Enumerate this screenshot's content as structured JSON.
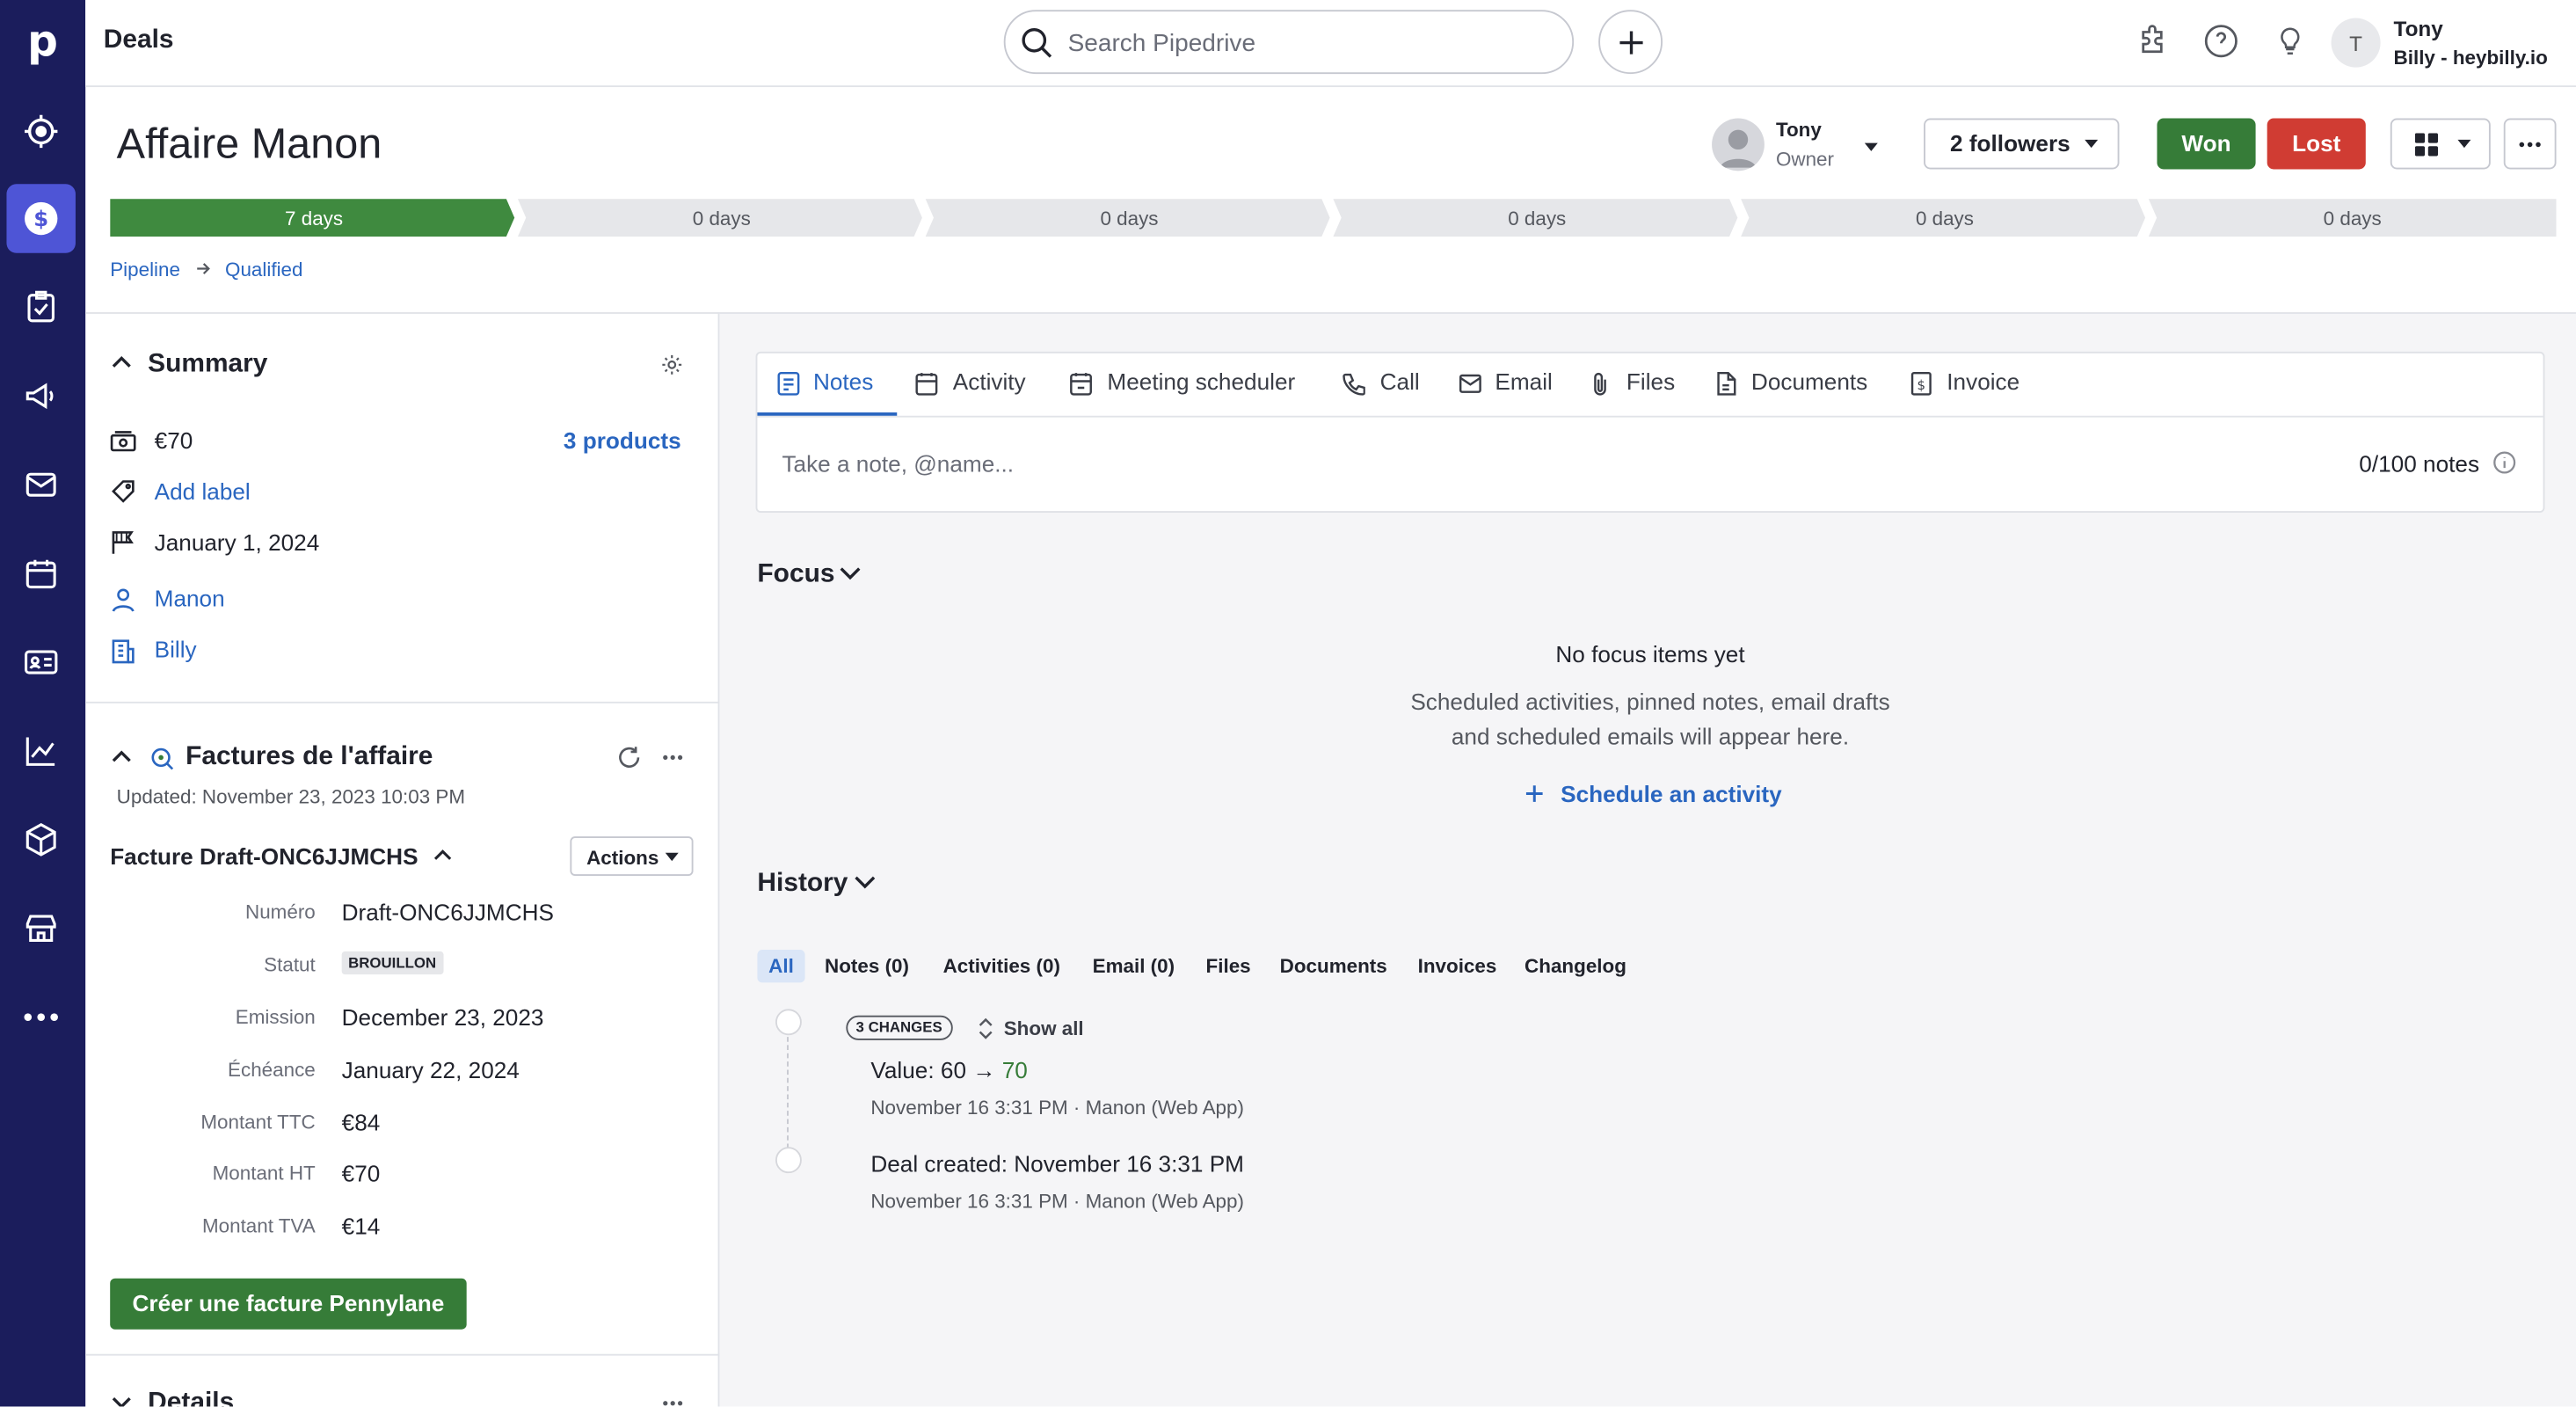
{
  "app": {
    "logo": "p",
    "section_title": "Deals"
  },
  "rail": {
    "items": [
      "focus-icon",
      "deals-icon",
      "activities-icon",
      "campaigns-icon",
      "mail-icon",
      "calendar-icon",
      "contacts-icon",
      "insights-icon",
      "products-icon",
      "marketplace-icon",
      "more-icon"
    ]
  },
  "search": {
    "placeholder": "Search Pipedrive"
  },
  "user": {
    "initial": "T",
    "name": "Tony",
    "company": "Billy - heybilly.io"
  },
  "deal": {
    "title": "Affaire Manon",
    "owner_name": "Tony",
    "owner_role": "Owner",
    "followers": "2 followers",
    "won": "Won",
    "lost": "Lost"
  },
  "stages": [
    {
      "label": "7 days",
      "progress": 1
    },
    {
      "label": "0 days",
      "progress": 0
    },
    {
      "label": "0 days",
      "progress": 0
    },
    {
      "label": "0 days",
      "progress": 0
    },
    {
      "label": "0 days",
      "progress": 0
    },
    {
      "label": "0 days",
      "progress": 0
    }
  ],
  "breadcrumb": {
    "pipeline": "Pipeline",
    "stage": "Qualified"
  },
  "summary": {
    "title": "Summary",
    "value": "€70",
    "products": "3 products",
    "add_label": "Add label",
    "close_date": "January 1, 2024",
    "person": "Manon",
    "org": "Billy"
  },
  "invoices": {
    "title": "Factures de l'affaire",
    "updated": "Updated: November 23, 2023 10:03 PM",
    "invoice_name": "Facture Draft-ONC6JJMCHS",
    "actions": "Actions",
    "fields": [
      {
        "label": "Numéro",
        "value": "Draft-ONC6JJMCHS"
      },
      {
        "label": "Statut",
        "value": "BROUILLON"
      },
      {
        "label": "Emission",
        "value": "December 23, 2023"
      },
      {
        "label": "Échéance",
        "value": "January 22, 2024"
      },
      {
        "label": "Montant TTC",
        "value": "€84"
      },
      {
        "label": "Montant HT",
        "value": "€70"
      },
      {
        "label": "Montant TVA",
        "value": "€14"
      }
    ],
    "create_button": "Créer une facture Pennylane"
  },
  "details_title": "Details",
  "tabs": [
    "Notes",
    "Activity",
    "Meeting scheduler",
    "Call",
    "Email",
    "Files",
    "Documents",
    "Invoice"
  ],
  "notes": {
    "placeholder": "Take a note, @name...",
    "count": "0/100 notes"
  },
  "focus": {
    "title": "Focus",
    "empty_title": "No focus items yet",
    "empty_line1": "Scheduled activities, pinned notes, email drafts",
    "empty_line2": "and scheduled emails will appear here.",
    "schedule": "Schedule an activity"
  },
  "history": {
    "title": "History",
    "tabs": [
      "All",
      "Notes (0)",
      "Activities (0)",
      "Email (0)",
      "Files",
      "Documents",
      "Invoices",
      "Changelog"
    ],
    "changes_badge": "3 CHANGES",
    "show_all": "Show all",
    "item1": {
      "label": "Value",
      "sep": ":",
      "old": "60",
      "arrow": "→",
      "new": "70",
      "meta": "November 16 3:31 PM · Manon (Web App)"
    },
    "item2": {
      "label": "Deal created",
      "sep": ":",
      "value": "November 16 3:31 PM",
      "meta": "November 16 3:31 PM · Manon (Web App)"
    }
  },
  "colors": {
    "rail": "#1b1d5c",
    "rail_active": "#4e55d6",
    "won": "#367c38",
    "lost": "#d03c33",
    "link": "#2a66c0",
    "stage_done": "#3f8a3f",
    "stage_todo": "#e6e7ea"
  }
}
